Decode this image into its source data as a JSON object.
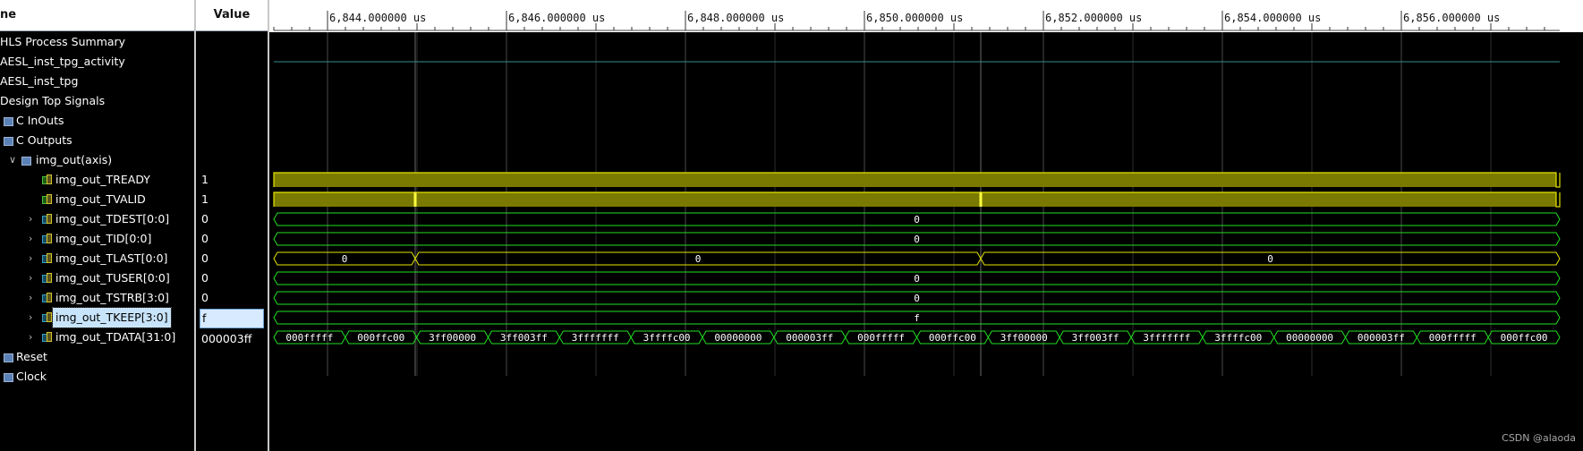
{
  "headers": {
    "name": "ne",
    "value": "Value"
  },
  "time_labels": [
    "6,844.000000 us",
    "6,846.000000 us",
    "6,848.000000 us",
    "6,850.000000 us",
    "6,852.000000 us",
    "6,854.000000 us",
    "6,856.000000 us"
  ],
  "tree": [
    {
      "label": "HLS Process Summary",
      "value": ""
    },
    {
      "label": "AESL_inst_tpg_activity",
      "value": ""
    },
    {
      "label": "AESL_inst_tpg",
      "value": ""
    },
    {
      "label": "Design Top Signals",
      "value": ""
    },
    {
      "label": "C InOuts",
      "value": ""
    },
    {
      "label": "C Outputs",
      "value": ""
    },
    {
      "label": "img_out(axis)",
      "value": ""
    },
    {
      "label": "img_out_TREADY",
      "value": "1"
    },
    {
      "label": "img_out_TVALID",
      "value": "1"
    },
    {
      "label": "img_out_TDEST[0:0]",
      "value": "0"
    },
    {
      "label": "img_out_TID[0:0]",
      "value": "0"
    },
    {
      "label": "img_out_TLAST[0:0]",
      "value": "0"
    },
    {
      "label": "img_out_TUSER[0:0]",
      "value": "0"
    },
    {
      "label": "img_out_TSTRB[3:0]",
      "value": "0"
    },
    {
      "label": "img_out_TKEEP[3:0]",
      "value": "f"
    },
    {
      "label": "img_out_TDATA[31:0]",
      "value": "000003ff"
    },
    {
      "label": "Reset",
      "value": ""
    },
    {
      "label": "Clock",
      "value": ""
    }
  ],
  "bus_labels": {
    "tdest": "0",
    "tid": "0",
    "tlast": [
      "0",
      "0",
      "0"
    ],
    "tuser": "0",
    "tstrb": "0",
    "tkeep": "f",
    "tdata": [
      "000fffff",
      "000ffc00",
      "3ff00000",
      "3ff003ff",
      "3fffffff",
      "3ffffc00",
      "00000000",
      "000003ff",
      "000fffff",
      "000ffc00",
      "3ff00000",
      "3ff003ff",
      "3fffffff",
      "3ffffc00",
      "00000000",
      "000003ff",
      "000fffff",
      "000ffc00"
    ]
  },
  "colors": {
    "bus": "#22e022",
    "scalar": "#e3e300",
    "scalar_fill": "#7a7a00",
    "grid": "#4a4a4a"
  },
  "watermark": "CSDN @alaoda"
}
